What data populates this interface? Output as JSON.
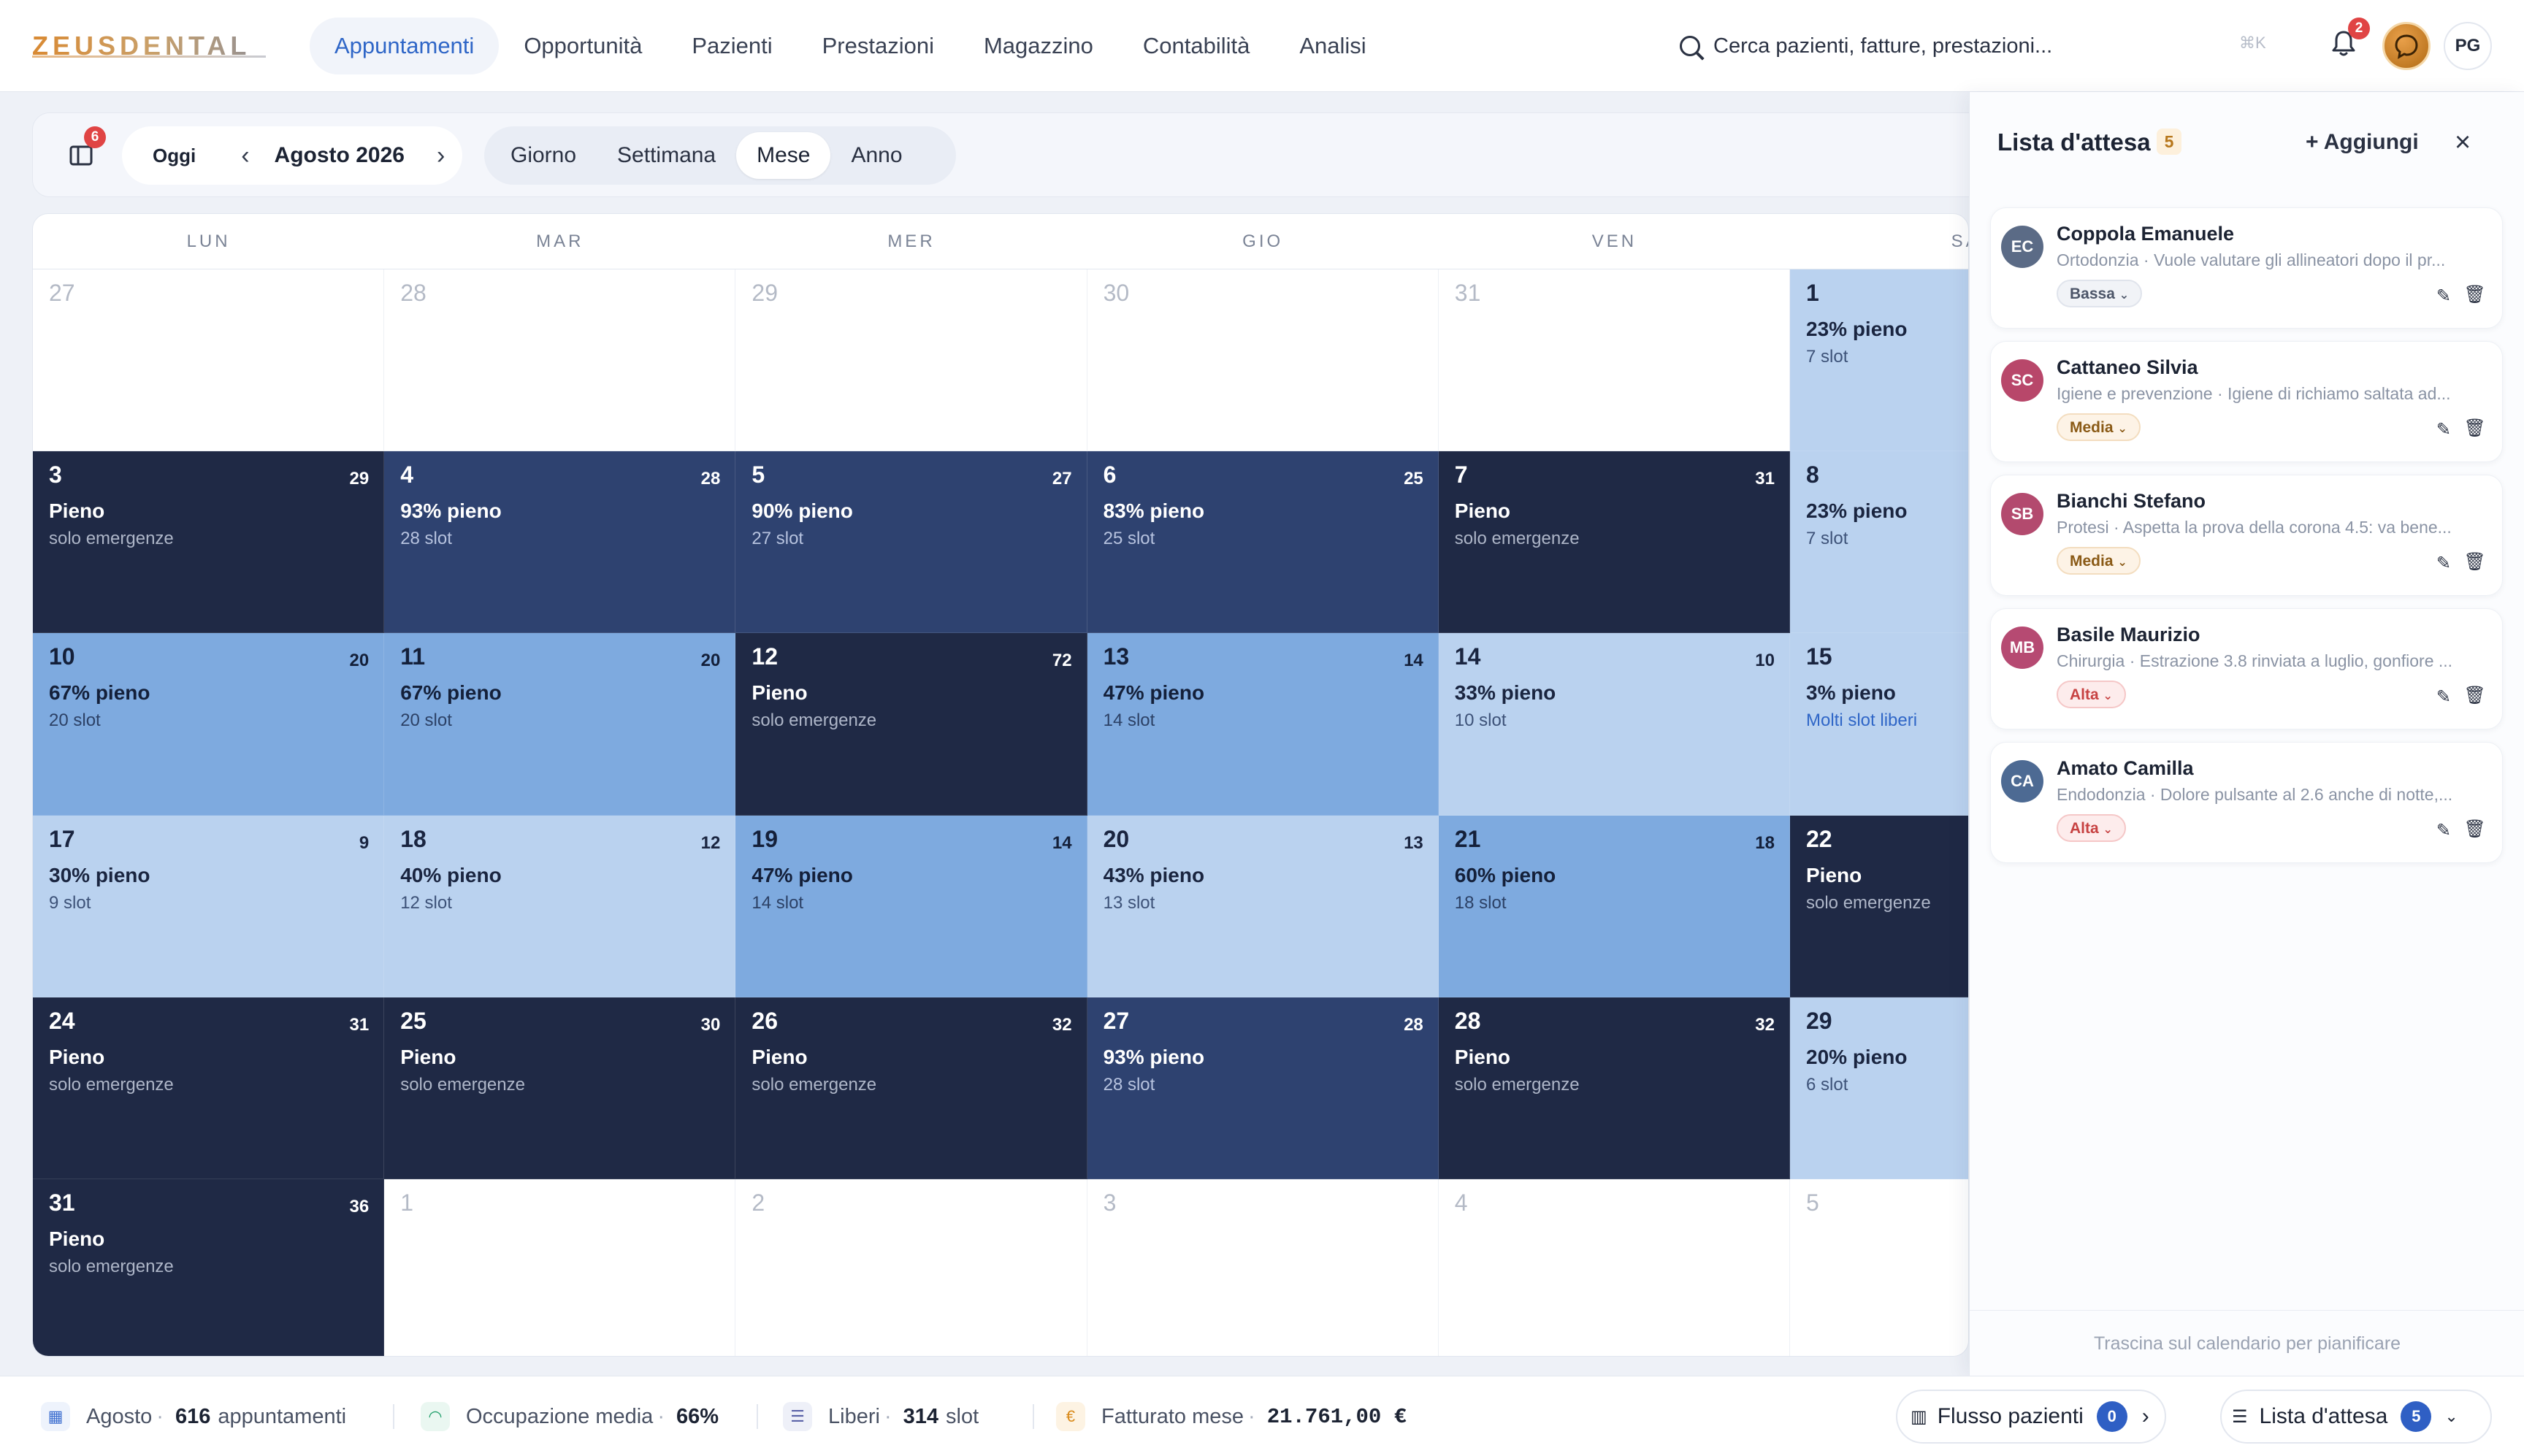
{
  "app": {
    "brand": "ZEUSDENTAL",
    "nav": [
      "Appuntamenti",
      "Opportunità",
      "Pazienti",
      "Prestazioni",
      "Magazzino",
      "Contabilità",
      "Analisi"
    ],
    "active_nav": "Appuntamenti",
    "search_placeholder": "Cerca pazienti, fatture, prestazioni...",
    "shortcut": "⌘K",
    "notifications_count": "2",
    "user_initials": "PG"
  },
  "toolbar": {
    "panel_badge": "6",
    "today": "Oggi",
    "month": "Agosto 2026",
    "views": [
      "Giorno",
      "Settimana",
      "Mese",
      "Anno"
    ],
    "active_view": "Mese"
  },
  "calendar": {
    "weekdays": [
      "LUN",
      "MAR",
      "MER",
      "GIO",
      "VEN",
      "SA"
    ],
    "weeks": [
      [
        {
          "day": "27",
          "out": true
        },
        {
          "day": "28",
          "out": true
        },
        {
          "day": "29",
          "out": true
        },
        {
          "day": "30",
          "out": true
        },
        {
          "day": "31",
          "out": true
        },
        {
          "day": "1",
          "level": "low",
          "pct": "23% pieno",
          "sub": "7 slot"
        }
      ],
      [
        {
          "day": "3",
          "count": "29",
          "level": "full",
          "pct": "Pieno",
          "sub": "solo emergenze"
        },
        {
          "day": "4",
          "count": "28",
          "level": "high",
          "pct": "93% pieno",
          "sub": "28 slot"
        },
        {
          "day": "5",
          "count": "27",
          "level": "high",
          "pct": "90% pieno",
          "sub": "27 slot"
        },
        {
          "day": "6",
          "count": "25",
          "level": "high",
          "pct": "83% pieno",
          "sub": "25 slot"
        },
        {
          "day": "7",
          "count": "31",
          "level": "full",
          "pct": "Pieno",
          "sub": "solo emergenze"
        },
        {
          "day": "8",
          "level": "low",
          "pct": "23% pieno",
          "sub": "7 slot"
        }
      ],
      [
        {
          "day": "10",
          "count": "20",
          "level": "mid",
          "pct": "67% pieno",
          "sub": "20 slot"
        },
        {
          "day": "11",
          "count": "20",
          "level": "mid",
          "pct": "67% pieno",
          "sub": "20 slot"
        },
        {
          "day": "12",
          "count": "72",
          "level": "full",
          "pct": "Pieno",
          "sub": "solo emergenze"
        },
        {
          "day": "13",
          "count": "14",
          "level": "mid",
          "pct": "47% pieno",
          "sub": "14 slot"
        },
        {
          "day": "14",
          "count": "10",
          "level": "low",
          "pct": "33% pieno",
          "sub": "10 slot"
        },
        {
          "day": "15",
          "level": "low",
          "pct": "3% pieno",
          "sub": "Molti slot liberi",
          "accent": true
        }
      ],
      [
        {
          "day": "17",
          "count": "9",
          "level": "low",
          "pct": "30% pieno",
          "sub": "9 slot"
        },
        {
          "day": "18",
          "count": "12",
          "level": "low",
          "pct": "40% pieno",
          "sub": "12 slot"
        },
        {
          "day": "19",
          "count": "14",
          "level": "mid",
          "pct": "47% pieno",
          "sub": "14 slot"
        },
        {
          "day": "20",
          "count": "13",
          "level": "low",
          "pct": "43% pieno",
          "sub": "13 slot"
        },
        {
          "day": "21",
          "count": "18",
          "level": "mid",
          "pct": "60% pieno",
          "sub": "18 slot"
        },
        {
          "day": "22",
          "level": "full",
          "pct": "Pieno",
          "sub": "solo emergenze"
        }
      ],
      [
        {
          "day": "24",
          "count": "31",
          "level": "full",
          "pct": "Pieno",
          "sub": "solo emergenze"
        },
        {
          "day": "25",
          "count": "30",
          "level": "full",
          "pct": "Pieno",
          "sub": "solo emergenze"
        },
        {
          "day": "26",
          "count": "32",
          "level": "full",
          "pct": "Pieno",
          "sub": "solo emergenze"
        },
        {
          "day": "27",
          "count": "28",
          "level": "high",
          "pct": "93% pieno",
          "sub": "28 slot"
        },
        {
          "day": "28",
          "count": "32",
          "level": "full",
          "pct": "Pieno",
          "sub": "solo emergenze"
        },
        {
          "day": "29",
          "level": "low",
          "pct": "20% pieno",
          "sub": "6 slot"
        }
      ],
      [
        {
          "day": "31",
          "count": "36",
          "level": "full",
          "pct": "Pieno",
          "sub": "solo emergenze"
        },
        {
          "day": "1",
          "out": true
        },
        {
          "day": "2",
          "out": true
        },
        {
          "day": "3",
          "out": true
        },
        {
          "day": "4",
          "out": true
        },
        {
          "day": "5",
          "out": true
        }
      ]
    ],
    "colors": {
      "full": "#1f2945",
      "high": "#2e4270",
      "mid": "#7eaadf",
      "low": "#bad2ef"
    }
  },
  "waitlist": {
    "title": "Lista d'attesa",
    "count": "5",
    "add_label": "+ Aggiungi",
    "footer": "Trascina sul calendario per pianificare",
    "items": [
      {
        "initials": "EC",
        "color": "#5b6b86",
        "name": "Coppola Emanuele",
        "desc": "Ortodonzia · Vuole valutare gli allineatori dopo il pr...",
        "priority": "Bassa",
        "priority_level": "low"
      },
      {
        "initials": "SC",
        "color": "#b8476a",
        "name": "Cattaneo Silvia",
        "desc": "Igiene e prevenzione · Igiene di richiamo saltata ad...",
        "priority": "Media",
        "priority_level": "mid"
      },
      {
        "initials": "SB",
        "color": "#b34a6e",
        "name": "Bianchi Stefano",
        "desc": "Protesi · Aspetta la prova della corona 4.5: va bene...",
        "priority": "Media",
        "priority_level": "mid"
      },
      {
        "initials": "MB",
        "color": "#b64a72",
        "name": "Basile Maurizio",
        "desc": "Chirurgia · Estrazione 3.8 rinviata a luglio, gonfiore ...",
        "priority": "Alta",
        "priority_level": "high"
      },
      {
        "initials": "CA",
        "color": "#4d6a93",
        "name": "Amato Camilla",
        "desc": "Endodonzia · Dolore pulsante al 2.6 anche di notte,...",
        "priority": "Alta",
        "priority_level": "high"
      }
    ]
  },
  "statusbar": {
    "month_label": "Agosto",
    "appointments": "616",
    "appointments_label": "appuntamenti",
    "occupancy_label": "Occupazione media",
    "occupancy": "66%",
    "free_label": "Liberi",
    "free": "314",
    "free_unit": "slot",
    "revenue_label": "Fatturato mese",
    "revenue": "21.761,00 €",
    "flow_label": "Flusso pazienti",
    "flow_count": "0",
    "waitlist_label": "Lista d'attesa",
    "waitlist_count": "5"
  }
}
